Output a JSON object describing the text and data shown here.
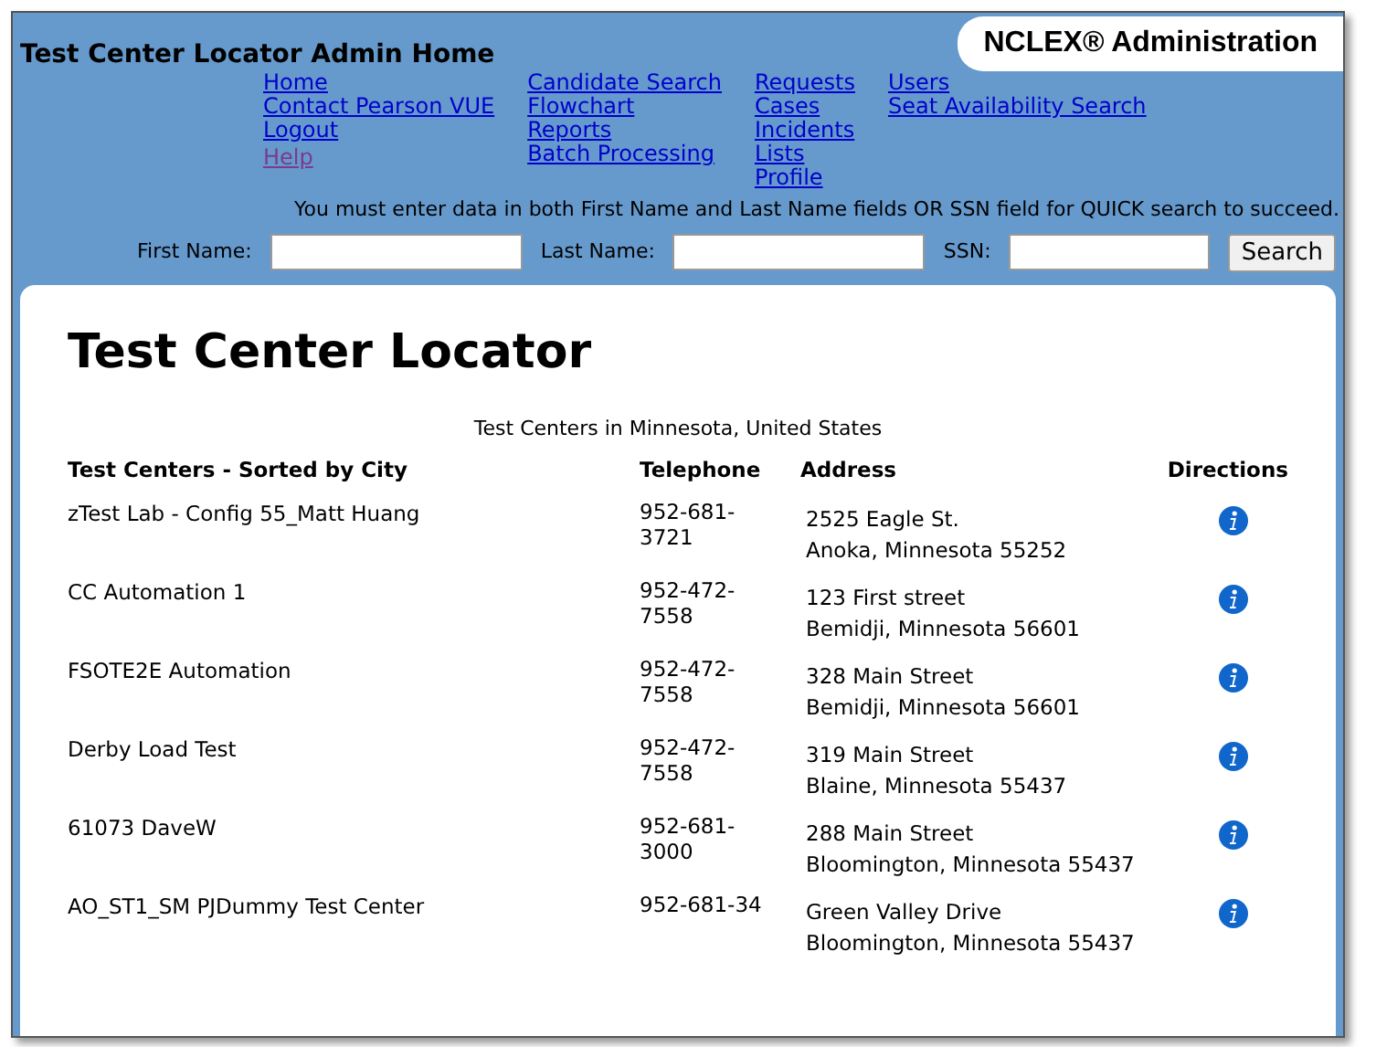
{
  "header": {
    "title": "Test Center Locator Admin Home",
    "badge": "NCLEX® Administration"
  },
  "nav_columns": [
    [
      {
        "label": "Home",
        "visited": false
      },
      {
        "label": "Contact Pearson VUE",
        "visited": false
      },
      {
        "label": "Logout",
        "visited": false
      },
      {
        "label": "Help",
        "visited": true
      }
    ],
    [
      {
        "label": "Candidate Search",
        "visited": false
      },
      {
        "label": "Flowchart",
        "visited": false
      },
      {
        "label": "Reports",
        "visited": false
      },
      {
        "label": "Batch Processing",
        "visited": false
      }
    ],
    [
      {
        "label": "Requests",
        "visited": false
      },
      {
        "label": "Cases",
        "visited": false
      },
      {
        "label": "Incidents",
        "visited": false
      },
      {
        "label": "Lists",
        "visited": false
      },
      {
        "label": "Profile",
        "visited": false
      }
    ],
    [
      {
        "label": "Users",
        "visited": false
      },
      {
        "label": "Seat Availability Search",
        "visited": false
      }
    ]
  ],
  "quick_search": {
    "hint": "You must enter data in both First Name and Last Name fields OR SSN field for QUICK search to succeed.",
    "fields": [
      {
        "label": "First Name:"
      },
      {
        "label": "Last Name:"
      },
      {
        "label": "SSN:"
      }
    ],
    "button": "Search"
  },
  "page_title": "Test Center Locator",
  "table": {
    "caption": "Test Centers in Minnesota, United States",
    "columns": [
      "Test Centers - Sorted by City",
      "Telephone",
      "Address",
      "Directions"
    ],
    "rows": [
      {
        "name": "zTest Lab - Config 55_Matt Huang",
        "phone": "952-681-3721",
        "street": "2525 Eagle St.",
        "city": "Anoka, Minnesota 55252"
      },
      {
        "name": "CC Automation 1",
        "phone": "952-472-7558",
        "street": "123 First street",
        "city": "Bemidji, Minnesota 56601"
      },
      {
        "name": "FSOTE2E Automation",
        "phone": "952-472-7558",
        "street": "328 Main Street",
        "city": "Bemidji, Minnesota 56601"
      },
      {
        "name": "Derby Load Test",
        "phone": "952-472-7558",
        "street": "319 Main Street",
        "city": "Blaine, Minnesota 55437"
      },
      {
        "name": "61073 DaveW",
        "phone": "952-681-3000",
        "street": "288 Main Street",
        "city": "Bloomington, Minnesota 55437"
      },
      {
        "name": "AO_ST1_SM PJDummy Test Center",
        "phone": "952-681-34",
        "street": "Green Valley Drive",
        "city": "Bloomington, Minnesota 55437"
      }
    ]
  }
}
